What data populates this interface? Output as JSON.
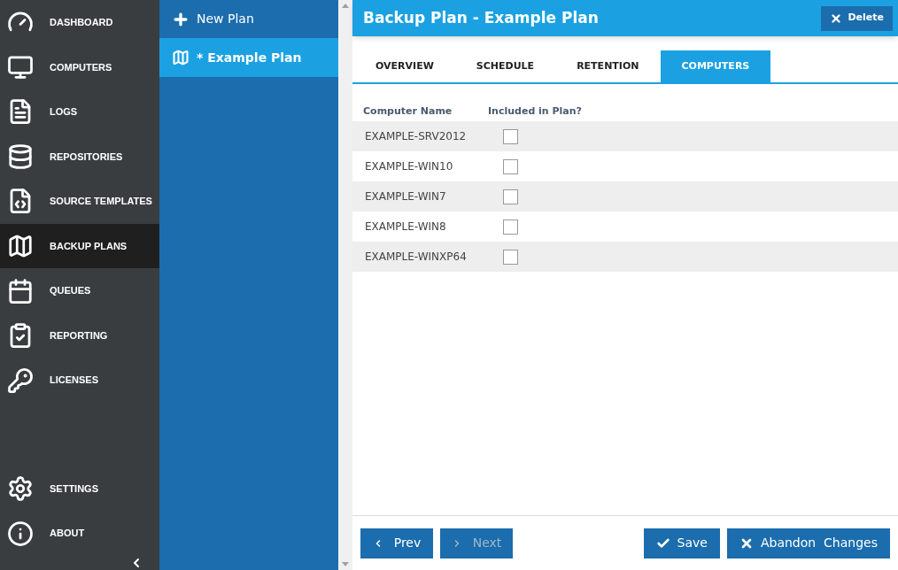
{
  "nav": {
    "items": [
      {
        "label": "DASHBOARD",
        "selected": false
      },
      {
        "label": "COMPUTERS",
        "selected": false
      },
      {
        "label": "LOGS",
        "selected": false
      },
      {
        "label": "REPOSITORIES",
        "selected": false
      },
      {
        "label": "SOURCE TEMPLATES",
        "selected": false
      },
      {
        "label": "BACKUP PLANS",
        "selected": true
      },
      {
        "label": "QUEUES",
        "selected": false
      },
      {
        "label": "REPORTING",
        "selected": false
      },
      {
        "label": "LICENSES",
        "selected": false
      }
    ],
    "bottom_items": [
      {
        "label": "SETTINGS",
        "selected": false
      },
      {
        "label": "ABOUT",
        "selected": false
      }
    ]
  },
  "plans": {
    "new_label": "New Plan",
    "items": [
      {
        "label": "* Example Plan",
        "selected": true
      }
    ]
  },
  "header": {
    "title": "Backup Plan - Example Plan",
    "delete_label": "Delete"
  },
  "tabs": [
    {
      "label": "OVERVIEW",
      "selected": false
    },
    {
      "label": "SCHEDULE",
      "selected": false
    },
    {
      "label": "RETENTION",
      "selected": false
    },
    {
      "label": "COMPUTERS",
      "selected": true
    }
  ],
  "table": {
    "columns": [
      "Computer Name",
      "Included in Plan?"
    ],
    "rows": [
      {
        "name": "EXAMPLE-SRV2012",
        "checked": false
      },
      {
        "name": "EXAMPLE-WIN10",
        "checked": false
      },
      {
        "name": "EXAMPLE-WIN7",
        "checked": false
      },
      {
        "name": "EXAMPLE-WIN8",
        "checked": false
      },
      {
        "name": "EXAMPLE-WINXP64",
        "checked": false
      }
    ]
  },
  "footer": {
    "prev": {
      "label": "Prev",
      "disabled": false
    },
    "next": {
      "label": "Next",
      "disabled": true
    },
    "save": "Save",
    "abandon": "Abandon  Changes"
  }
}
